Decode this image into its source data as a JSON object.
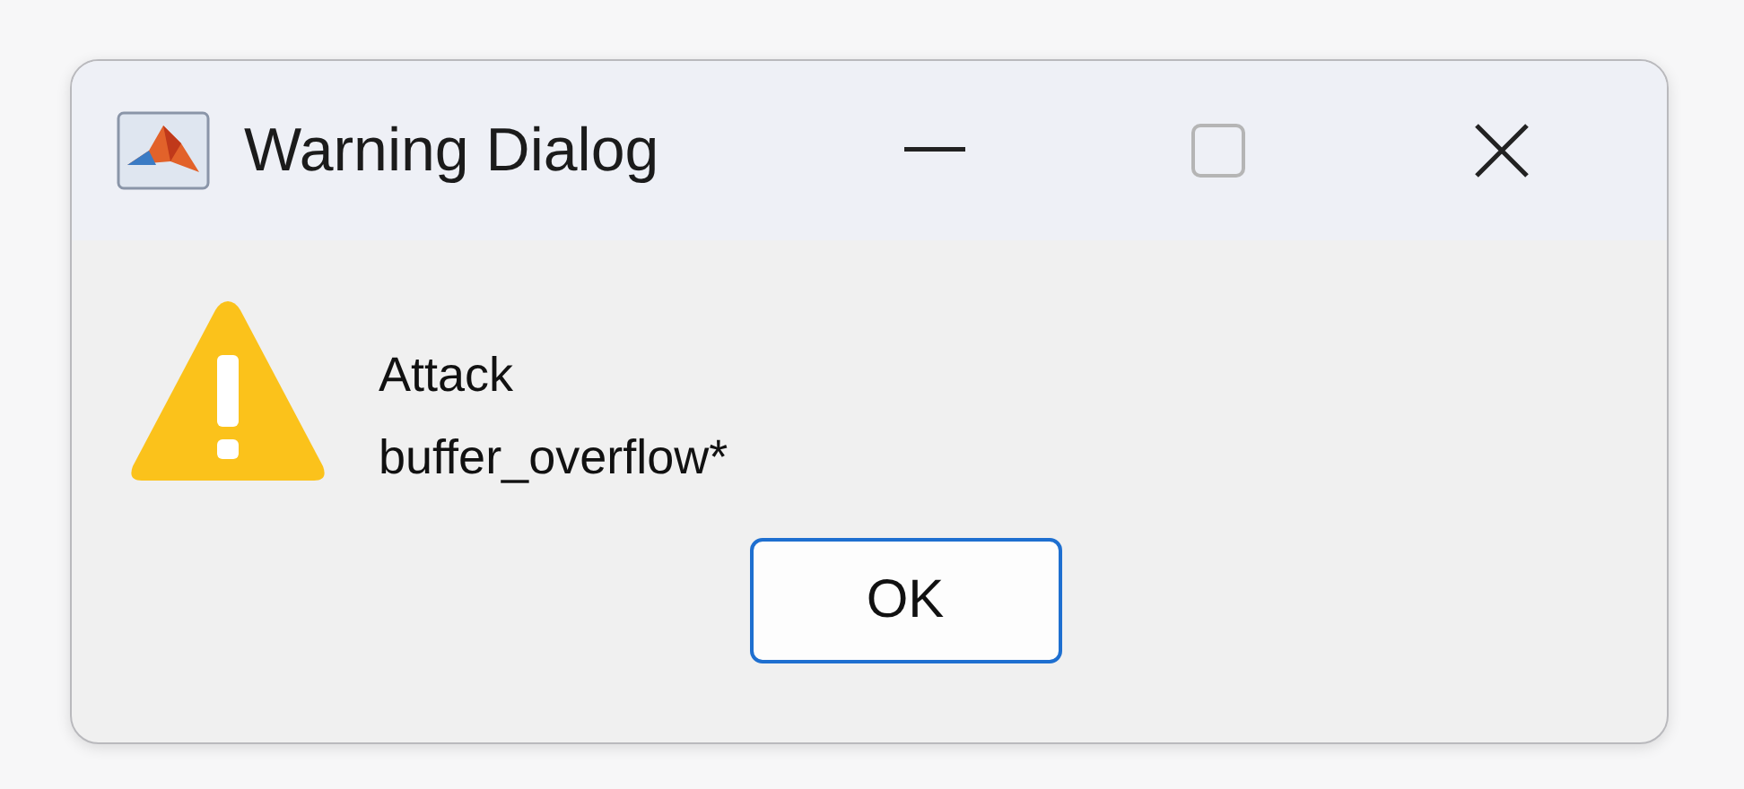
{
  "window": {
    "title": "Warning Dialog"
  },
  "message": {
    "lines": [
      "Attack",
      "buffer_overflow*"
    ]
  },
  "buttons": [
    {
      "label": "OK",
      "selected": true
    }
  ]
}
